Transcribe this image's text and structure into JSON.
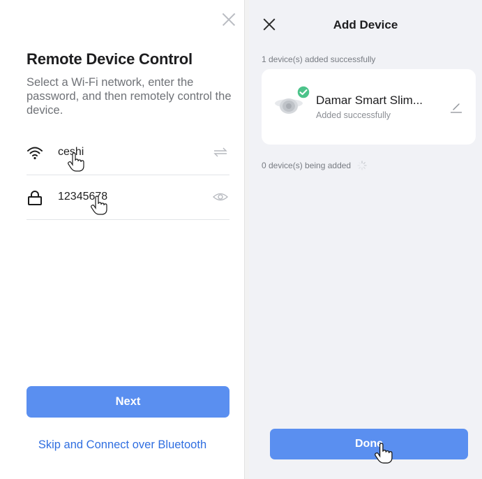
{
  "left_screen": {
    "title": "Remote Device Control",
    "description": "Select a Wi-Fi network, enter the password, and then remotely control the device.",
    "wifi_field": {
      "value": "ceshi",
      "icon": "wifi-icon",
      "trailing_icon": "switch-network-icon"
    },
    "password_field": {
      "value": "12345678",
      "icon": "lock-icon",
      "trailing_icon": "eye-icon"
    },
    "next_label": "Next",
    "bluetooth_link": "Skip and Connect over Bluetooth"
  },
  "right_screen": {
    "title": "Add Device",
    "added_count_text": "1 device(s) added successfully",
    "device": {
      "name": "Damar Smart Slim...",
      "status": "Added successfully",
      "status_badge_icon": "check-circle-icon",
      "edit_icon": "pencil-icon"
    },
    "pending_count_text": "0 device(s) being added",
    "done_label": "Done"
  },
  "colors": {
    "primary_button": "#5a8ff0",
    "link": "#2f6ee0",
    "success_badge": "#4cc38a",
    "right_background": "#f1f2f6"
  }
}
